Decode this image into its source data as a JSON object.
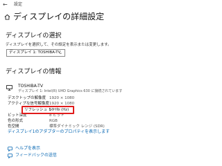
{
  "titlebar": {
    "app": "設定",
    "back_icon": "back-arrow-icon"
  },
  "page": {
    "title": "ディスプレイの詳細設定",
    "home_icon": "home-icon"
  },
  "select_section": {
    "heading": "ディスプレイの選択",
    "description": "ディスプレイを選択して、その設定を表示または変更します。",
    "dropdown_value": "ディスプレイ 1: TOSHIBA-TV"
  },
  "info_section": {
    "heading": "ディスプレイの情報",
    "monitor_name": "TOSHIBA-TV",
    "monitor_sub": "ディスプレイ 1: Intel(R) UHD Graphics 630 に接続されています",
    "rows": [
      {
        "key": "デスクトップの解像度",
        "value": "1920 × 1080"
      },
      {
        "key": "アクティブな信号解像度",
        "value": "1920 × 1080"
      },
      {
        "key": "リフレッシュ レート (Hz)",
        "value": "59 Hz"
      },
      {
        "key": "ビット深度",
        "value": "8 ビット"
      },
      {
        "key": "色の形式",
        "value": "RGB"
      },
      {
        "key": "色空間",
        "value": "標準ダイナミック レンジ (SDR)"
      }
    ],
    "adapter_link": "ディスプレイ1のアダプターのプロパティを表示します"
  },
  "footer": {
    "help_link": "ヘルプを表示",
    "feedback_link": "フィードバックの送信"
  },
  "colors": {
    "accent": "#0063b1",
    "highlight": "#e01b1b"
  }
}
